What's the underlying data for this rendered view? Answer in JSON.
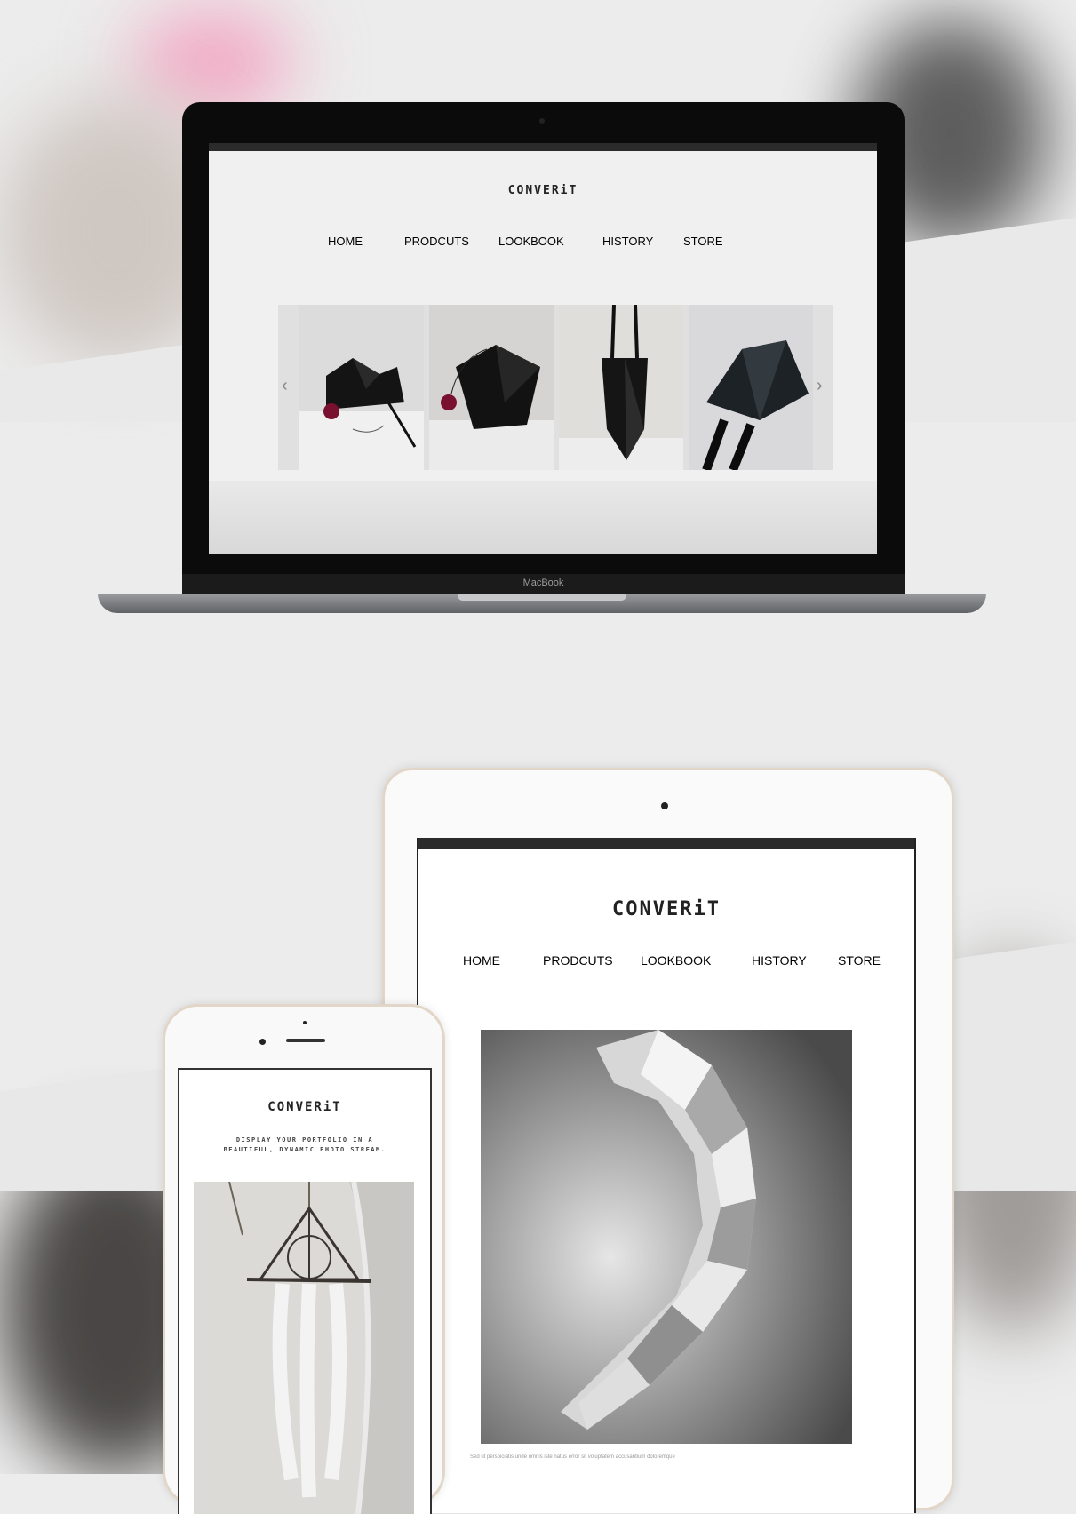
{
  "laptop": {
    "brand_label": "MacBook",
    "site": {
      "logo": "CONVERiT",
      "nav": [
        "HOME",
        "PRODCUTS",
        "LOOKBOOK",
        "HISTORY",
        "STORE"
      ],
      "carousel": {
        "prev_icon": "chevron-left-icon",
        "next_icon": "chevron-right-icon",
        "prev_glyph": "‹",
        "next_glyph": "›",
        "slides": [
          "black-origami-bag-1",
          "black-origami-bag-2",
          "black-origami-tote",
          "black-origami-shoulder-bag"
        ]
      }
    }
  },
  "tablet": {
    "site": {
      "logo": "CONVERiT",
      "nav": [
        "HOME",
        "PRODCUTS",
        "LOOKBOOK",
        "HISTORY",
        "STORE"
      ],
      "hero_image": "folded-paper-spiral",
      "caption": "Sed ut perspiciatis unde omnis iste natus error sit voluptatem accusantium doloremque"
    }
  },
  "phone": {
    "site": {
      "logo": "CONVERiT",
      "tagline_line1": "DISPLAY YOUR PORTFOLIO IN A",
      "tagline_line2": "BEAUTIFUL, DYNAMIC PHOTO STREAM.",
      "hero_image": "dreamcatcher"
    }
  },
  "colors": {
    "background": "#ececec",
    "device_frame_gold": "#e2d6c8",
    "laptop_body": "#0b0b0b",
    "text_dark": "#333333"
  }
}
